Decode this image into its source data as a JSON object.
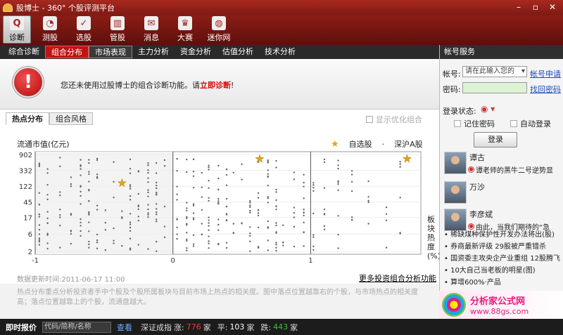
{
  "app": {
    "title": "股博士 - 360° 个股评测平台"
  },
  "window": {
    "minimize": "–",
    "restore": "▫",
    "close": "✕"
  },
  "toolbar": [
    {
      "label": "诊断",
      "icon": "magnifier-icon",
      "glyph": "Q",
      "active": true
    },
    {
      "label": "测股",
      "icon": "gauge-icon",
      "glyph": "◔"
    },
    {
      "label": "选股",
      "icon": "checklist-icon",
      "glyph": "✓"
    },
    {
      "label": "管股",
      "icon": "books-icon",
      "glyph": "▥"
    },
    {
      "label": "消息",
      "icon": "message-icon",
      "glyph": "✉"
    },
    {
      "label": "大赛",
      "icon": "trophy-icon",
      "glyph": "♛"
    },
    {
      "label": "迷你网",
      "icon": "globe-icon",
      "glyph": "◍"
    }
  ],
  "tabs": [
    {
      "label": "综合诊断"
    },
    {
      "label": "组合分布",
      "active": true
    },
    {
      "label": "市场表现",
      "hl": true
    },
    {
      "label": "主力分析"
    },
    {
      "label": "资金分析"
    },
    {
      "label": "估值分析"
    },
    {
      "label": "技术分析"
    }
  ],
  "notice": {
    "text": "您还未使用过股博士的组合诊断功能。请",
    "link": "立即诊断",
    "suffix": "!",
    "glyph": "!"
  },
  "subtabs": [
    {
      "label": "热点分布",
      "active": true
    },
    {
      "label": "组合风格"
    }
  ],
  "option_label": "显示优化组合",
  "chart_data": {
    "type": "scatter",
    "ylabel": "流通市值(亿元)",
    "y_ticks": [
      "902",
      "332",
      "122",
      "45",
      "17",
      "6",
      "2"
    ],
    "x_ticks": [
      "-1",
      "0",
      "1"
    ],
    "xlim": [
      -1,
      1.8
    ],
    "side_label": "板块热度(%)",
    "legend": [
      {
        "name": "自选股",
        "marker": "star",
        "color": "#e8a316"
      },
      {
        "name": "深沪A股",
        "marker": "dot",
        "color": "#666666"
      }
    ],
    "highlight": [
      {
        "x": -0.37,
        "y": 150
      },
      {
        "x": 0.63,
        "y": 1100
      },
      {
        "x": 1.7,
        "y": 850
      }
    ],
    "column_x": [
      -0.97,
      -0.91,
      -0.82,
      -0.74,
      -0.67,
      -0.61,
      -0.55,
      -0.49,
      -0.43,
      -0.37,
      -0.31,
      -0.25,
      -0.18,
      -0.12,
      -0.06,
      0.03,
      0.1,
      0.15,
      0.21,
      0.26,
      0.33,
      0.39,
      0.44,
      0.5,
      0.56,
      0.62,
      0.69,
      0.75,
      0.8,
      0.88,
      0.95,
      1.02,
      1.1,
      1.2,
      1.3,
      1.42,
      1.55,
      1.65
    ],
    "seed": 17
  },
  "chart_footer": {
    "updated": "数据更新时间:2011-06-17 11:00",
    "more": "更多投资组合分析功能"
  },
  "description": "热点分布重点分析投资者手中个股及个股所属板块与目前市场上热点的相关度。图中落点位置越靠右的个股，与市场热点的相关度高；落点位置越靠上的个股，流通盘越大。",
  "account": {
    "title": "帐号服务",
    "account_label": "帐号:",
    "account_placeholder": "请在此输入您的",
    "apply": "帐号申请",
    "password_label": "密码:",
    "find_password": "找回密码",
    "status_label": "登录状态:",
    "remember": "记住密码",
    "auto_login": "自动登录",
    "login": "登录"
  },
  "users": [
    {
      "name": "谭古",
      "msg": "谭老师的黑牛二号逆势显"
    },
    {
      "name": "万沙",
      "msg": ""
    },
    {
      "name": "李彦斌",
      "msg": "由此，当我们期待的“急"
    }
  ],
  "news": [
    "稀缺煤种保护性开发办法将出(股)",
    "券商最新评级 29股被严重错杀",
    "国资委主攻央企产业重组 12股腾飞",
    "10大自己当老板的明星(图)",
    "算增600%·产品"
  ],
  "watermark": {
    "t1": "分析家公式网",
    "t2": "www.88gs.com"
  },
  "bottom": {
    "title": "即时报价",
    "input": "代码/简称/名称",
    "view": "查看",
    "index": "深证成指",
    "up_label": "涨:",
    "up": "776",
    "flat_label": "平:",
    "flat": "103",
    "down_label": "跌:",
    "down": "443",
    "unit": "家"
  }
}
